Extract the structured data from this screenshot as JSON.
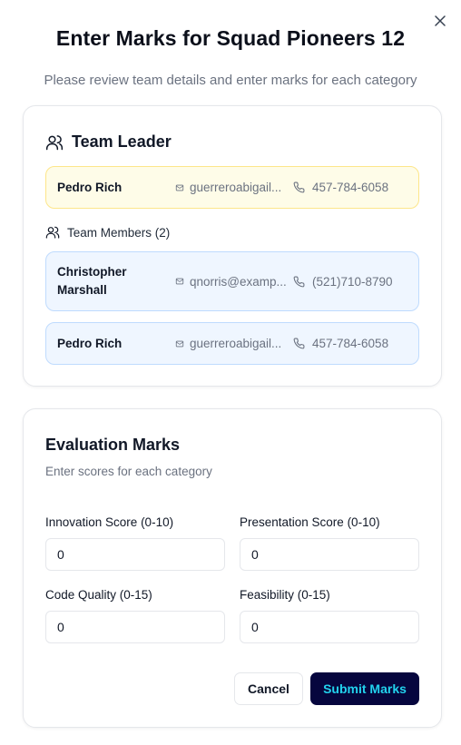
{
  "dialog": {
    "title": "Enter Marks for Squad Pioneers 12",
    "subtitle": "Please review team details and enter marks for each category",
    "close_icon": "close-icon"
  },
  "team": {
    "leader_heading": "Team Leader",
    "leader": {
      "name": "Pedro Rich",
      "email": "guerreroabigail...",
      "phone": "457-784-6058"
    },
    "members_heading": "Team Members (2)",
    "members": [
      {
        "name": "Christopher Marshall",
        "email": "qnorris@examp...",
        "phone": "(521)710-8790"
      },
      {
        "name": "Pedro Rich",
        "email": "guerreroabigail...",
        "phone": "457-784-6058"
      }
    ]
  },
  "evaluation": {
    "title": "Evaluation Marks",
    "subtitle": "Enter scores for each category",
    "fields": [
      {
        "label": "Innovation Score (0-10)",
        "value": "0"
      },
      {
        "label": "Presentation Score (0-10)",
        "value": "0"
      },
      {
        "label": "Code Quality (0-15)",
        "value": "0"
      },
      {
        "label": "Feasibility (0-15)",
        "value": "0"
      }
    ],
    "cancel_label": "Cancel",
    "submit_label": "Submit Marks"
  },
  "colors": {
    "leader_bg": "#fefce8",
    "member_bg": "#eff6ff",
    "submit_bg": "#06063e",
    "submit_text": "#22d3ee"
  }
}
